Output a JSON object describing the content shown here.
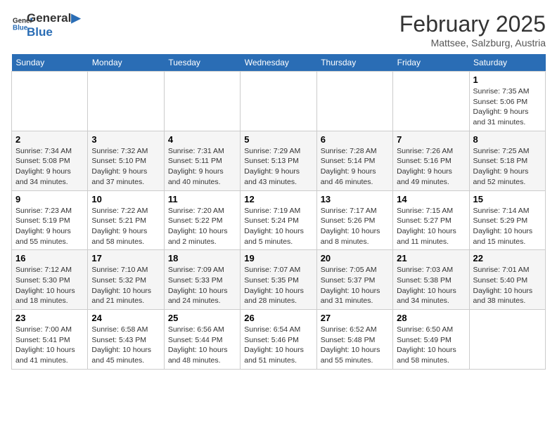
{
  "header": {
    "logo_line1": "General",
    "logo_line2": "Blue",
    "month": "February 2025",
    "location": "Mattsee, Salzburg, Austria"
  },
  "days_of_week": [
    "Sunday",
    "Monday",
    "Tuesday",
    "Wednesday",
    "Thursday",
    "Friday",
    "Saturday"
  ],
  "weeks": [
    [
      {
        "num": "",
        "info": ""
      },
      {
        "num": "",
        "info": ""
      },
      {
        "num": "",
        "info": ""
      },
      {
        "num": "",
        "info": ""
      },
      {
        "num": "",
        "info": ""
      },
      {
        "num": "",
        "info": ""
      },
      {
        "num": "1",
        "info": "Sunrise: 7:35 AM\nSunset: 5:06 PM\nDaylight: 9 hours and 31 minutes."
      }
    ],
    [
      {
        "num": "2",
        "info": "Sunrise: 7:34 AM\nSunset: 5:08 PM\nDaylight: 9 hours and 34 minutes."
      },
      {
        "num": "3",
        "info": "Sunrise: 7:32 AM\nSunset: 5:10 PM\nDaylight: 9 hours and 37 minutes."
      },
      {
        "num": "4",
        "info": "Sunrise: 7:31 AM\nSunset: 5:11 PM\nDaylight: 9 hours and 40 minutes."
      },
      {
        "num": "5",
        "info": "Sunrise: 7:29 AM\nSunset: 5:13 PM\nDaylight: 9 hours and 43 minutes."
      },
      {
        "num": "6",
        "info": "Sunrise: 7:28 AM\nSunset: 5:14 PM\nDaylight: 9 hours and 46 minutes."
      },
      {
        "num": "7",
        "info": "Sunrise: 7:26 AM\nSunset: 5:16 PM\nDaylight: 9 hours and 49 minutes."
      },
      {
        "num": "8",
        "info": "Sunrise: 7:25 AM\nSunset: 5:18 PM\nDaylight: 9 hours and 52 minutes."
      }
    ],
    [
      {
        "num": "9",
        "info": "Sunrise: 7:23 AM\nSunset: 5:19 PM\nDaylight: 9 hours and 55 minutes."
      },
      {
        "num": "10",
        "info": "Sunrise: 7:22 AM\nSunset: 5:21 PM\nDaylight: 9 hours and 58 minutes."
      },
      {
        "num": "11",
        "info": "Sunrise: 7:20 AM\nSunset: 5:22 PM\nDaylight: 10 hours and 2 minutes."
      },
      {
        "num": "12",
        "info": "Sunrise: 7:19 AM\nSunset: 5:24 PM\nDaylight: 10 hours and 5 minutes."
      },
      {
        "num": "13",
        "info": "Sunrise: 7:17 AM\nSunset: 5:26 PM\nDaylight: 10 hours and 8 minutes."
      },
      {
        "num": "14",
        "info": "Sunrise: 7:15 AM\nSunset: 5:27 PM\nDaylight: 10 hours and 11 minutes."
      },
      {
        "num": "15",
        "info": "Sunrise: 7:14 AM\nSunset: 5:29 PM\nDaylight: 10 hours and 15 minutes."
      }
    ],
    [
      {
        "num": "16",
        "info": "Sunrise: 7:12 AM\nSunset: 5:30 PM\nDaylight: 10 hours and 18 minutes."
      },
      {
        "num": "17",
        "info": "Sunrise: 7:10 AM\nSunset: 5:32 PM\nDaylight: 10 hours and 21 minutes."
      },
      {
        "num": "18",
        "info": "Sunrise: 7:09 AM\nSunset: 5:33 PM\nDaylight: 10 hours and 24 minutes."
      },
      {
        "num": "19",
        "info": "Sunrise: 7:07 AM\nSunset: 5:35 PM\nDaylight: 10 hours and 28 minutes."
      },
      {
        "num": "20",
        "info": "Sunrise: 7:05 AM\nSunset: 5:37 PM\nDaylight: 10 hours and 31 minutes."
      },
      {
        "num": "21",
        "info": "Sunrise: 7:03 AM\nSunset: 5:38 PM\nDaylight: 10 hours and 34 minutes."
      },
      {
        "num": "22",
        "info": "Sunrise: 7:01 AM\nSunset: 5:40 PM\nDaylight: 10 hours and 38 minutes."
      }
    ],
    [
      {
        "num": "23",
        "info": "Sunrise: 7:00 AM\nSunset: 5:41 PM\nDaylight: 10 hours and 41 minutes."
      },
      {
        "num": "24",
        "info": "Sunrise: 6:58 AM\nSunset: 5:43 PM\nDaylight: 10 hours and 45 minutes."
      },
      {
        "num": "25",
        "info": "Sunrise: 6:56 AM\nSunset: 5:44 PM\nDaylight: 10 hours and 48 minutes."
      },
      {
        "num": "26",
        "info": "Sunrise: 6:54 AM\nSunset: 5:46 PM\nDaylight: 10 hours and 51 minutes."
      },
      {
        "num": "27",
        "info": "Sunrise: 6:52 AM\nSunset: 5:48 PM\nDaylight: 10 hours and 55 minutes."
      },
      {
        "num": "28",
        "info": "Sunrise: 6:50 AM\nSunset: 5:49 PM\nDaylight: 10 hours and 58 minutes."
      },
      {
        "num": "",
        "info": ""
      }
    ]
  ]
}
